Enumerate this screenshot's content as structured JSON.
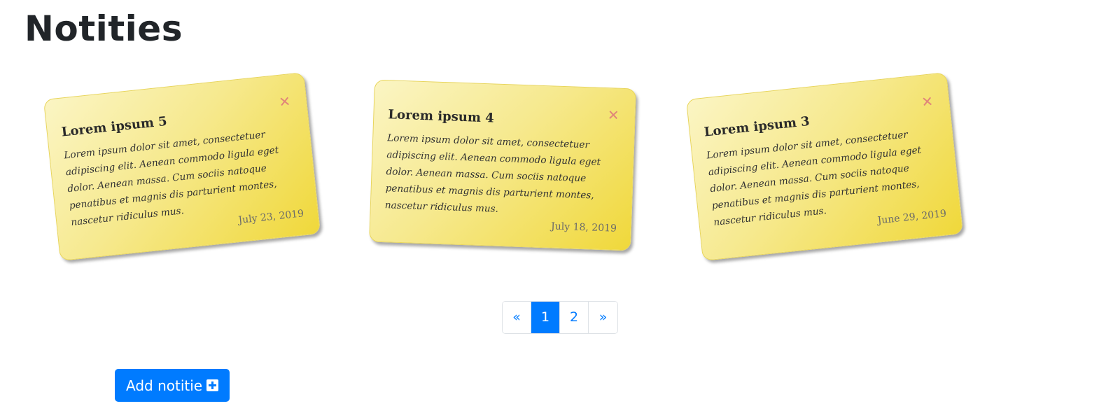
{
  "page": {
    "title": "Notities"
  },
  "notes": [
    {
      "title": "Lorem ipsum 5",
      "body": "Lorem ipsum dolor sit amet, consectetuer adipiscing elit. Aenean commodo ligula eget dolor. Aenean massa. Cum sociis natoque penatibus et magnis dis parturient montes, nascetur ridiculus mus.",
      "date": "July 23, 2019",
      "close_glyph": "✕"
    },
    {
      "title": "Lorem ipsum 4",
      "body": "Lorem ipsum dolor sit amet, consectetuer adipiscing elit. Aenean commodo ligula eget dolor. Aenean massa. Cum sociis natoque penatibus et magnis dis parturient montes, nascetur ridiculus mus.",
      "date": "July 18, 2019",
      "close_glyph": "✕"
    },
    {
      "title": "Lorem ipsum 3",
      "body": "Lorem ipsum dolor sit amet, consectetuer adipiscing elit. Aenean commodo ligula eget dolor. Aenean massa. Cum sociis natoque penatibus et magnis dis parturient montes, nascetur ridiculus mus.",
      "date": "June 29, 2019",
      "close_glyph": "✕"
    }
  ],
  "pagination": {
    "prev": "«",
    "pages": [
      "1",
      "2"
    ],
    "current": "1",
    "next": "»"
  },
  "actions": {
    "add_label": "Add notitie",
    "add_icon": "plus-square-icon"
  },
  "colors": {
    "primary": "#007bff",
    "note_light": "#fbf5c4",
    "note_dark": "#f0d83a",
    "close": "#e0857a"
  }
}
